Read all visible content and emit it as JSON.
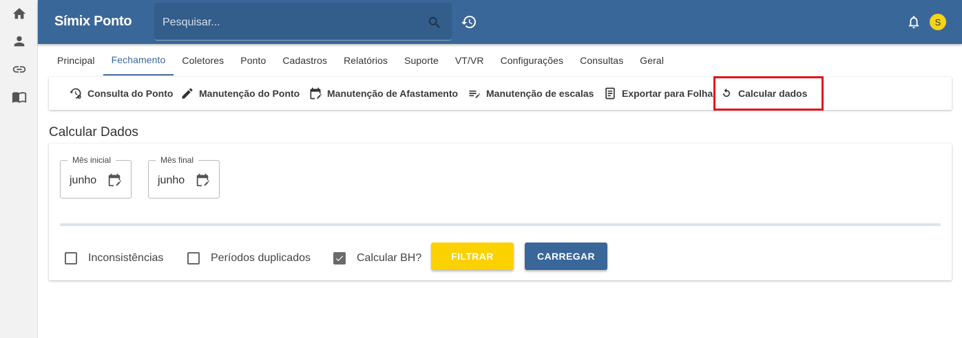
{
  "app": {
    "title": "Símix Ponto"
  },
  "search": {
    "placeholder": "Pesquisar..."
  },
  "user": {
    "avatar_initial": "S"
  },
  "rail": {
    "items": [
      "home-icon",
      "person-icon",
      "link-icon",
      "book-icon"
    ]
  },
  "tabs": [
    {
      "label": "Principal",
      "active": false
    },
    {
      "label": "Fechamento",
      "active": true
    },
    {
      "label": "Coletores",
      "active": false
    },
    {
      "label": "Ponto",
      "active": false
    },
    {
      "label": "Cadastros",
      "active": false
    },
    {
      "label": "Relatórios",
      "active": false
    },
    {
      "label": "Suporte",
      "active": false
    },
    {
      "label": "VT/VR",
      "active": false
    },
    {
      "label": "Configurações",
      "active": false
    },
    {
      "label": "Consultas",
      "active": false
    },
    {
      "label": "Geral",
      "active": false
    }
  ],
  "submenu": [
    {
      "label": "Consulta do Ponto",
      "icon": "clock-settings-icon"
    },
    {
      "label": "Manutenção do Ponto",
      "icon": "pencil-icon"
    },
    {
      "label": "Manutenção de Afastamento",
      "icon": "calendar-edit-icon"
    },
    {
      "label": "Manutenção de escalas",
      "icon": "list-edit-icon"
    },
    {
      "label": "Exportar para Folha",
      "icon": "document-icon"
    },
    {
      "label": "Calcular dados",
      "icon": "refresh-icon",
      "highlighted": true
    }
  ],
  "page": {
    "title": "Calcular Dados"
  },
  "form": {
    "start_month": {
      "label": "Mês inicial",
      "value": "junho"
    },
    "end_month": {
      "label": "Mês final",
      "value": "junho"
    },
    "checkboxes": [
      {
        "label": "Inconsistências",
        "checked": false
      },
      {
        "label": "Períodos duplicados",
        "checked": false
      },
      {
        "label": "Calcular BH?",
        "checked": true
      }
    ],
    "filter_label": "FILTRAR",
    "load_label": "CARREGAR"
  },
  "colors": {
    "primary": "#3a6799",
    "accent": "#fbd100",
    "highlight": "#e0151b"
  }
}
